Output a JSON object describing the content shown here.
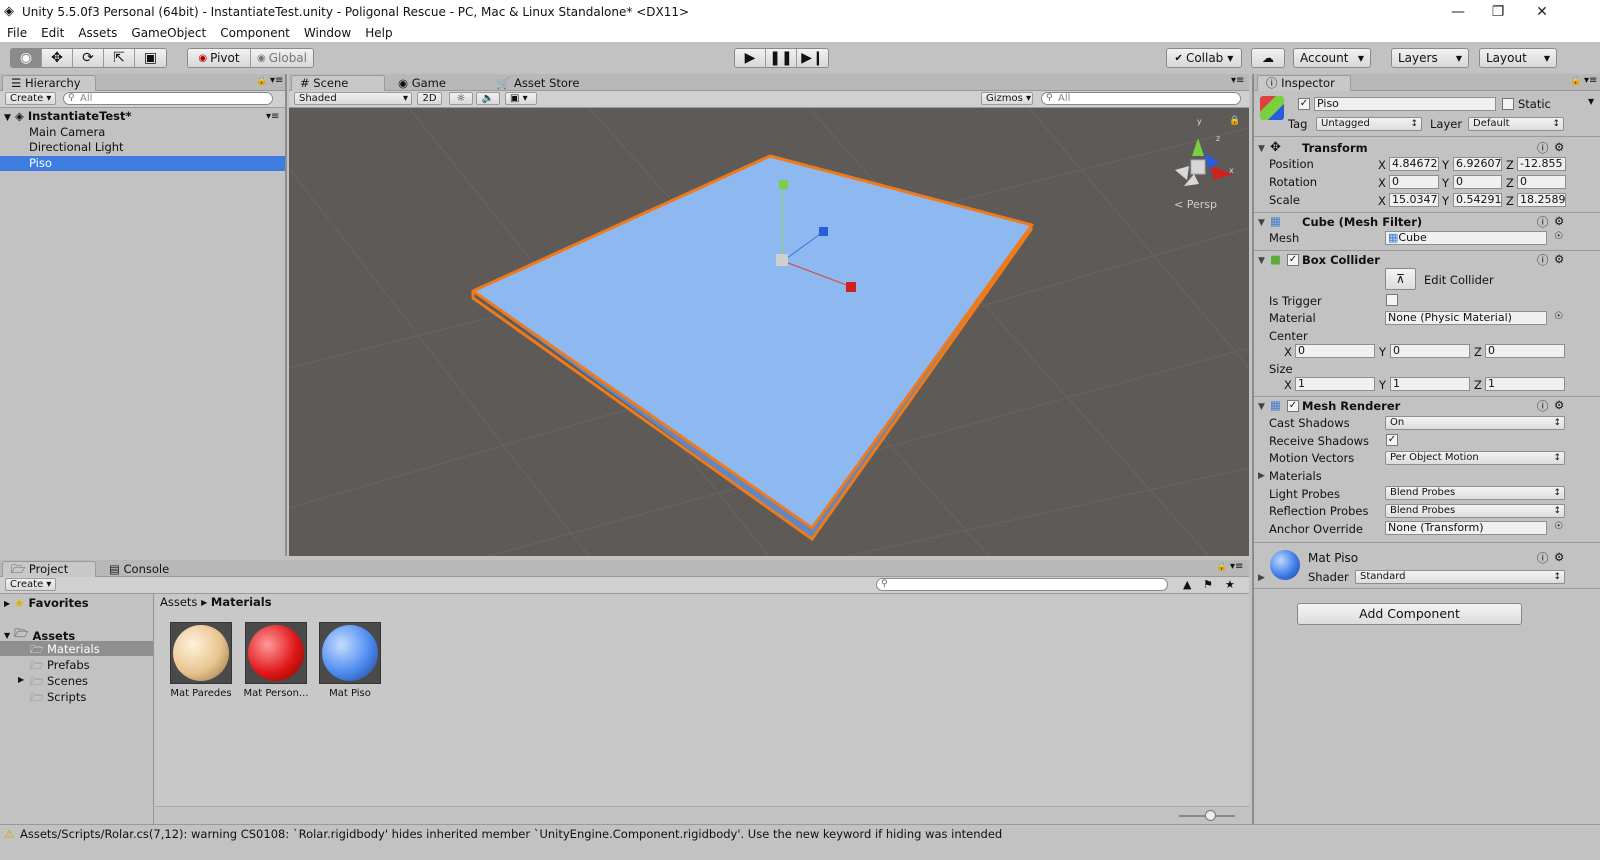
{
  "window": {
    "title": "Unity 5.5.0f3 Personal (64bit) - InstantiateTest.unity - Poligonal Rescue - PC, Mac & Linux Standalone* <DX11>"
  },
  "menu": [
    "File",
    "Edit",
    "Assets",
    "GameObject",
    "Component",
    "Window",
    "Help"
  ],
  "toolbar": {
    "pivot": "Pivot",
    "global": "Global",
    "collab": "Collab",
    "account": "Account",
    "layers": "Layers",
    "layout": "Layout"
  },
  "hierarchy": {
    "tab": "Hierarchy",
    "create": "Create",
    "search_placeholder": "All",
    "scene_name": "InstantiateTest*",
    "items": [
      "Main Camera",
      "Directional Light",
      "Piso"
    ],
    "selected": "Piso"
  },
  "scene": {
    "tabs": [
      "Scene",
      "Game",
      "Asset Store"
    ],
    "shading": "Shaded",
    "mode_2d": "2D",
    "gizmos": "Gizmos",
    "search_placeholder": "All",
    "persp": "Persp",
    "axis_y": "y",
    "axis_z": "z",
    "axis_x": "x"
  },
  "inspector": {
    "tab": "Inspector",
    "name": "Piso",
    "static_label": "Static",
    "tag_label": "Tag",
    "tag": "Untagged",
    "layer_label": "Layer",
    "layer": "Default",
    "transform": {
      "title": "Transform",
      "position_label": "Position",
      "rotation_label": "Rotation",
      "scale_label": "Scale",
      "position": [
        "4.84672",
        "6.92607",
        "-12.855"
      ],
      "rotation": [
        "0",
        "0",
        "0"
      ],
      "scale": [
        "15.0347",
        "0.54291",
        "18.2589"
      ]
    },
    "mesh_filter": {
      "title": "Cube (Mesh Filter)",
      "mesh_label": "Mesh",
      "mesh": "Cube"
    },
    "box_collider": {
      "title": "Box Collider",
      "edit": "Edit Collider",
      "is_trigger": "Is Trigger",
      "material_label": "Material",
      "material": "None (Physic Material)",
      "center_label": "Center",
      "center": [
        "0",
        "0",
        "0"
      ],
      "size_label": "Size",
      "size": [
        "1",
        "1",
        "1"
      ]
    },
    "mesh_renderer": {
      "title": "Mesh Renderer",
      "cast_shadows_label": "Cast Shadows",
      "cast_shadows": "On",
      "receive_shadows_label": "Receive Shadows",
      "motion_vectors_label": "Motion Vectors",
      "motion_vectors": "Per Object Motion",
      "materials_label": "Materials",
      "light_probes_label": "Light Probes",
      "light_probes": "Blend Probes",
      "reflection_probes_label": "Reflection Probes",
      "reflection_probes": "Blend Probes",
      "anchor_override_label": "Anchor Override",
      "anchor_override": "None (Transform)"
    },
    "material": {
      "name": "Mat Piso",
      "shader_label": "Shader",
      "shader": "Standard"
    },
    "add_component": "Add Component"
  },
  "project": {
    "tabs": [
      "Project",
      "Console"
    ],
    "create": "Create",
    "favorites": "Favorites",
    "assets": "Assets",
    "folders": [
      "Materials",
      "Prefabs",
      "Scenes",
      "Scripts"
    ],
    "breadcrumb": [
      "Assets",
      "Materials"
    ],
    "items": [
      {
        "name": "Mat Paredes",
        "color": "#e8c48e"
      },
      {
        "name": "Mat Person...",
        "color": "#e01818"
      },
      {
        "name": "Mat Piso",
        "color": "#4d8cf0"
      }
    ]
  },
  "status": {
    "message": "Assets/Scripts/Rolar.cs(7,12): warning CS0108: `Rolar.rigidbody' hides inherited member `UnityEngine.Component.rigidbody'. Use the new keyword if hiding was intended"
  },
  "colors": {
    "selection": "#3e7ce0",
    "plane": "#8db8f0",
    "outline": "#f07a1a",
    "viewport": "#5e5a57"
  }
}
